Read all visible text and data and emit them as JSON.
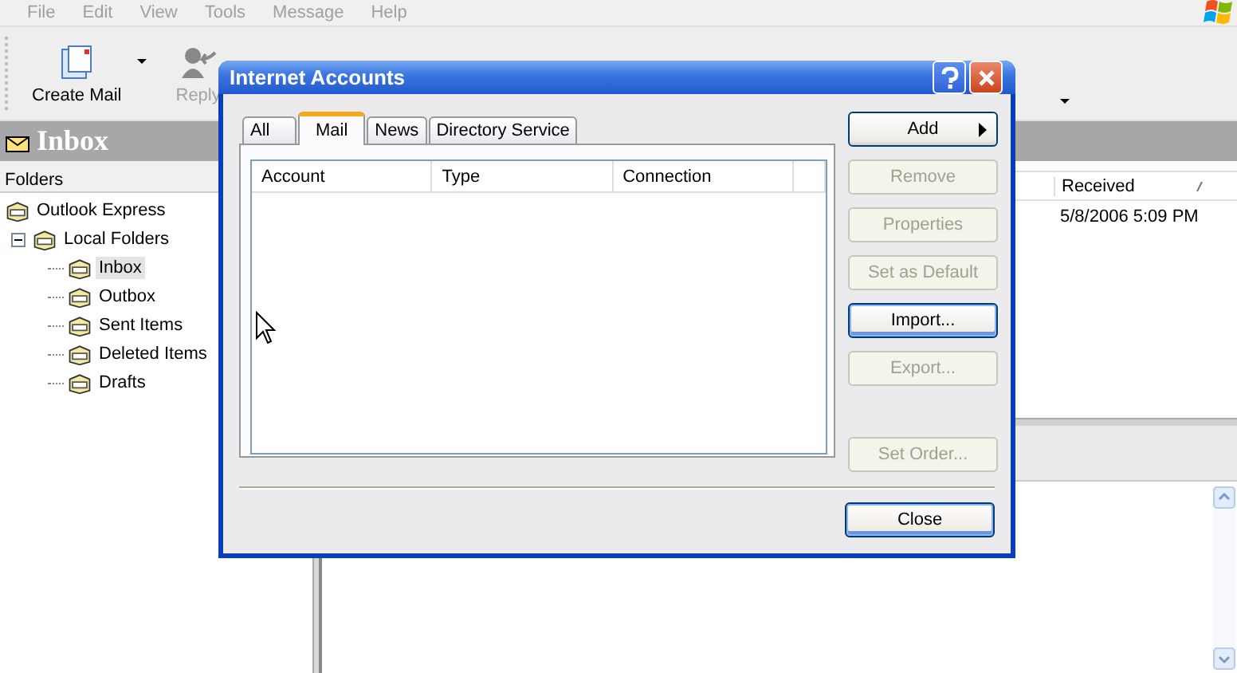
{
  "menu_bar": [
    "File",
    "Edit",
    "View",
    "Tools",
    "Message",
    "Help"
  ],
  "toolbar": [
    {
      "label": "Create Mail",
      "disabled": false,
      "dropdown": true
    },
    {
      "label": "Reply",
      "disabled": true,
      "dropdown": false
    }
  ],
  "folder_title": "Inbox",
  "folders": {
    "header": "Folders",
    "tree": [
      {
        "label": "Outlook Express",
        "selected": false,
        "children": [
          {
            "label": "Local Folders",
            "selected": false,
            "expanded": true,
            "children": [
              {
                "label": "Inbox",
                "selected": true
              },
              {
                "label": "Outbox",
                "selected": false
              },
              {
                "label": "Sent Items",
                "selected": false
              },
              {
                "label": "Deleted Items",
                "selected": false
              },
              {
                "label": "Drafts",
                "selected": false
              }
            ]
          }
        ]
      }
    ]
  },
  "message_list": {
    "columns": [
      "Received"
    ],
    "rows": [
      [
        "5/8/2006 5:09 PM"
      ]
    ]
  },
  "dialog": {
    "title": "Internet Accounts",
    "tabs": [
      {
        "label": "All",
        "selected": false
      },
      {
        "label": "Mail",
        "selected": true
      },
      {
        "label": "News",
        "selected": false
      },
      {
        "label": "Directory Service",
        "selected": false
      }
    ],
    "columns": [
      "Account",
      "Type",
      "Connection"
    ],
    "buttons": [
      {
        "label": "Add",
        "kind": "menu",
        "disabled": false,
        "focused": false
      },
      {
        "label": "Remove",
        "kind": "plain",
        "disabled": true,
        "focused": false
      },
      {
        "label": "Properties",
        "kind": "plain",
        "disabled": true,
        "focused": false
      },
      {
        "label": "Set as Default",
        "kind": "plain",
        "disabled": true,
        "focused": false
      },
      {
        "label": "Import...",
        "kind": "plain",
        "disabled": false,
        "focused": true
      },
      {
        "label": "Export...",
        "kind": "plain",
        "disabled": true,
        "focused": false
      },
      {
        "label": "Set Order...",
        "kind": "spaced",
        "disabled": true,
        "focused": false
      }
    ],
    "close_button": {
      "label": "Close",
      "default": true
    }
  }
}
